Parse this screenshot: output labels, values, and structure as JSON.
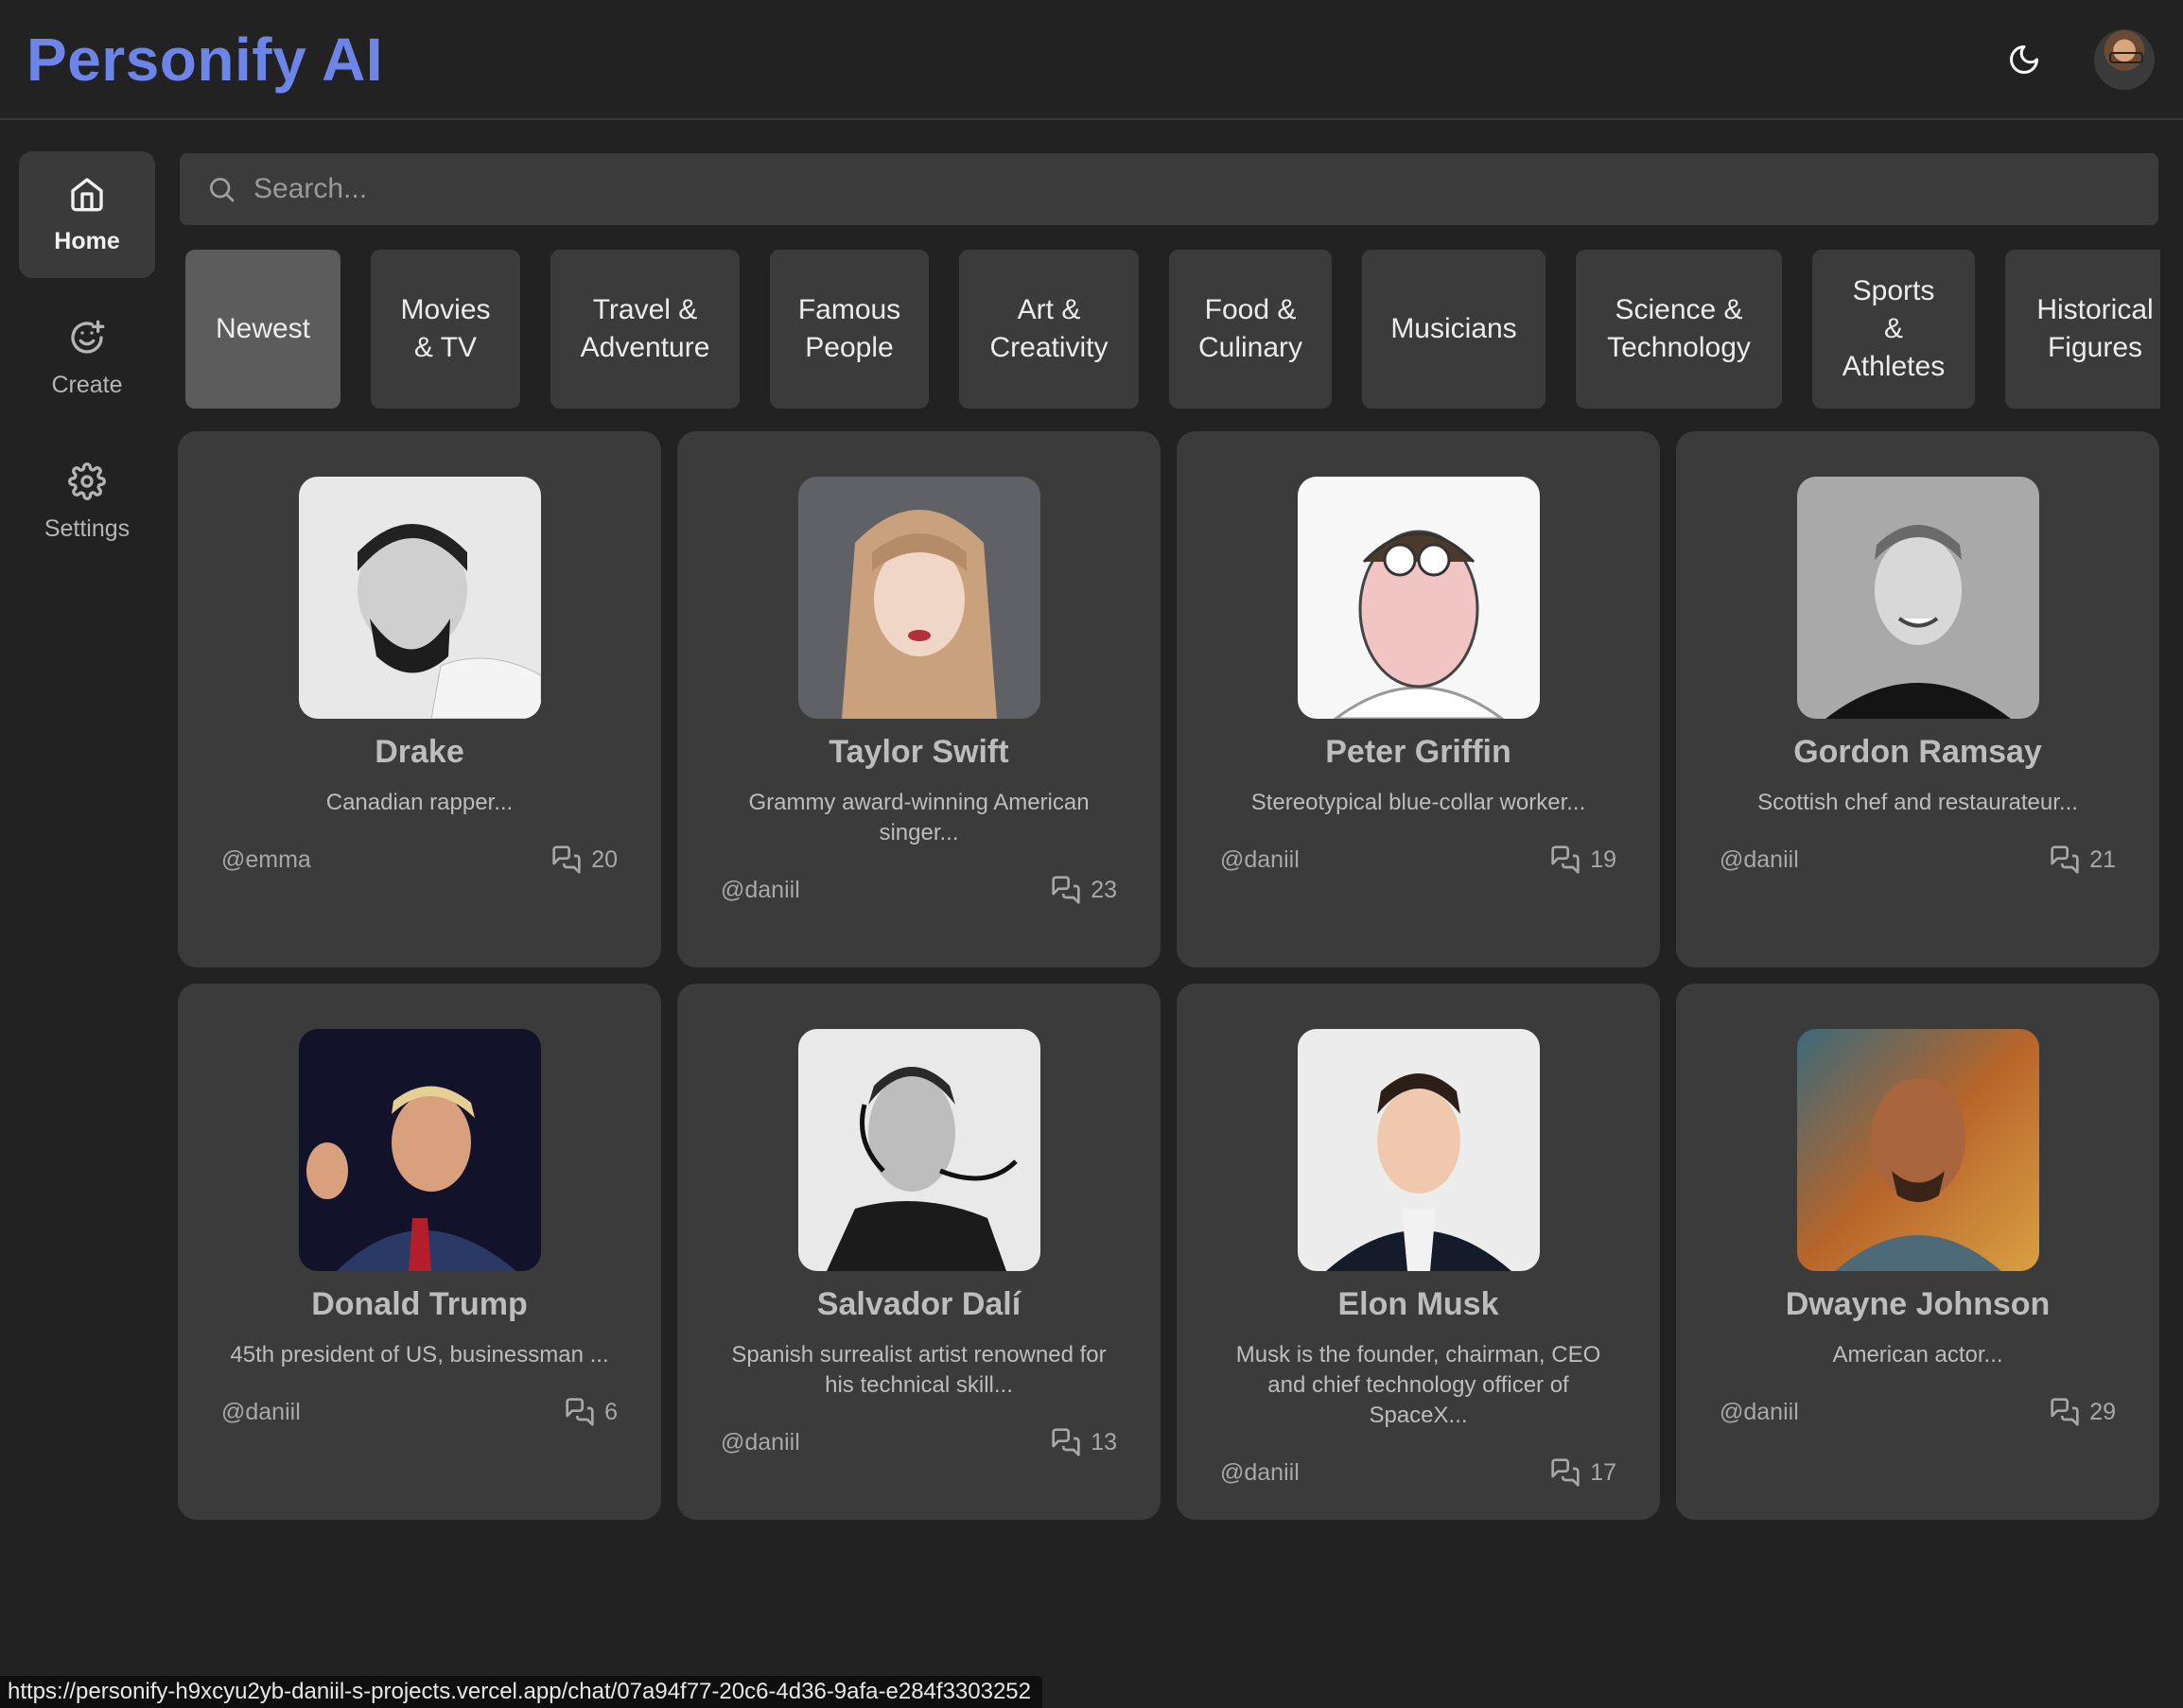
{
  "app": {
    "title": "Personify AI"
  },
  "header": {
    "theme_icon": "moon-icon",
    "avatar": "user-avatar"
  },
  "sidebar": {
    "items": [
      {
        "label": "Home",
        "icon": "home-icon"
      },
      {
        "label": "Create",
        "icon": "create-icon"
      },
      {
        "label": "Settings",
        "icon": "gear-icon"
      }
    ]
  },
  "search": {
    "placeholder": "Search...",
    "value": ""
  },
  "categories": [
    "Newest",
    "Movies\n& TV",
    "Travel &\nAdventure",
    "Famous\nPeople",
    "Art &\nCreativity",
    "Food &\nCulinary",
    "Musicians",
    "Science &\nTechnology",
    "Sports\n&\nAthletes",
    "Historical\nFigures"
  ],
  "characters": [
    {
      "name": "Drake",
      "description": "Canadian rapper...",
      "author": "@emma",
      "chats": "20"
    },
    {
      "name": "Taylor Swift",
      "description": "Grammy award-winning American singer...",
      "author": "@daniil",
      "chats": "23"
    },
    {
      "name": "Peter Griffin",
      "description": "Stereotypical blue-collar worker...",
      "author": "@daniil",
      "chats": "19"
    },
    {
      "name": "Gordon Ramsay",
      "description": "Scottish chef and restaurateur...",
      "author": "@daniil",
      "chats": "21"
    },
    {
      "name": "Donald Trump",
      "description": "45th president of US, businessman ...",
      "author": "@daniil",
      "chats": "6"
    },
    {
      "name": "Salvador Dalí",
      "description": "Spanish surrealist artist renowned for his technical skill...",
      "author": "@daniil",
      "chats": "13"
    },
    {
      "name": "Elon Musk",
      "description": "Musk is the founder, chairman, CEO and chief technology officer of SpaceX...",
      "author": "@daniil",
      "chats": "17"
    },
    {
      "name": "Dwayne Johnson",
      "description": "American actor...",
      "author": "@daniil",
      "chats": "29"
    }
  ],
  "status_url": "https://personify-h9xcyu2yb-daniil-s-projects.vercel.app/chat/07a94f77-20c6-4d36-9afa-e284f3303252"
}
